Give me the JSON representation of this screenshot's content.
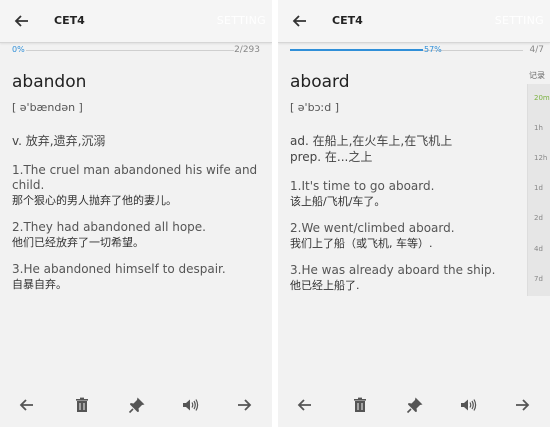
{
  "left": {
    "app_title": "CET4",
    "setting_label": "SETTING",
    "progress_percent_label": "0%",
    "progress_fraction": 0.0,
    "progress_count": "2/293",
    "word": "abandon",
    "phonetic": "[ ə'bændən ]",
    "definitions": [
      "v. 放弃,遗弃,沉溺"
    ],
    "examples": [
      {
        "en": "1.The cruel man abandoned his wife and child.",
        "zh": "那个狠心的男人抛弃了他的妻儿。"
      },
      {
        "en": "2.They had abandoned all hope.",
        "zh": "他们已经放弃了一切希望。"
      },
      {
        "en": "3.He abandoned himself to despair.",
        "zh": "自暴自弃。"
      }
    ]
  },
  "right": {
    "app_title": "CET4",
    "setting_label": "SETTING",
    "progress_percent_label": "57%",
    "progress_fraction": 0.57,
    "progress_count": "4/7",
    "word": "aboard",
    "phonetic": "[ ə'bɔːd ]",
    "definitions": [
      "ad. 在船上,在火车上,在飞机上",
      "prep. 在...之上"
    ],
    "examples": [
      {
        "en": "1.It's time to go aboard.",
        "zh": "该上船/飞机/车了。"
      },
      {
        "en": "2.We went/climbed aboard.",
        "zh": "我们上了船（或飞机, 车等）."
      },
      {
        "en": "3.He was already aboard the ship.",
        "zh": "他已经上船了."
      }
    ],
    "record_panel": {
      "title": "记录",
      "items": [
        "20m",
        "1h",
        "12h",
        "1d",
        "2d",
        "4d",
        "7d"
      ],
      "active_index": 0,
      "active_color": "#7cb342"
    }
  },
  "icons": [
    "back-arrow-icon",
    "previous-arrow-icon",
    "trash-icon",
    "pin-icon",
    "speaker-icon",
    "next-arrow-icon"
  ],
  "accent_color": "#2f8fd8"
}
